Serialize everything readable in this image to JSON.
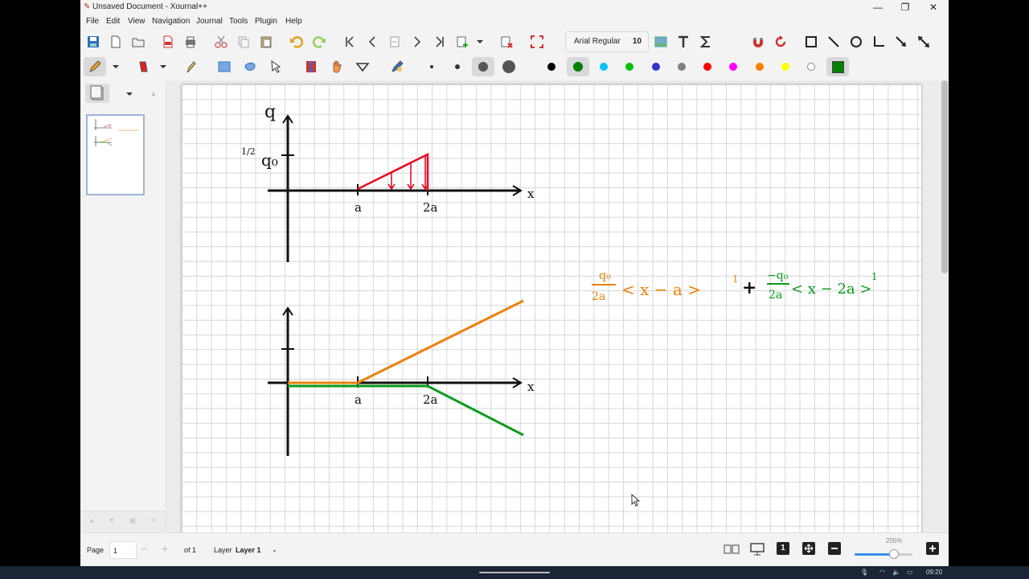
{
  "window": {
    "title": "Unsaved Document - Xournal++",
    "controls": [
      "—",
      "❐",
      "✕"
    ]
  },
  "menu": [
    "File",
    "Edit",
    "View",
    "Navigation",
    "Journal",
    "Tools",
    "Plugin",
    "Help"
  ],
  "toolbar": {
    "font_name": "Arial Regular",
    "font_size": "10",
    "palette": [
      "#000000",
      "#008000",
      "#00c0ff",
      "#00c000",
      "#3333cc",
      "#808080",
      "#ff0000",
      "#ff00ff",
      "#ff8000",
      "#ffff00",
      "#ffffff",
      "#008000"
    ]
  },
  "canvas": {
    "label_q": "q",
    "label_half_q0": "q₀",
    "label_half_frac": "1/2",
    "label_a_top": "a",
    "label_2a_top": "2a",
    "label_x_top": "x",
    "label_a_bot": "a",
    "label_2a_bot": "2a",
    "label_x_bot": "x",
    "eq_orange_num": "q₀",
    "eq_orange_den": "2a",
    "eq_orange_body": "< x − a >",
    "eq_orange_exp": "1",
    "eq_plus": "+",
    "eq_green_num": "−q₀",
    "eq_green_den": "2a",
    "eq_green_body": "< x − 2a >",
    "eq_green_exp": "1",
    "colors": {
      "red": "#e0102a",
      "orange": "#e8820a",
      "green": "#0b9a1e",
      "ink": "#111111"
    }
  },
  "status": {
    "page_label": "Page",
    "page_value": "1",
    "of_label": "of 1",
    "layer_label": "Layer",
    "layer_value": "Layer 1",
    "zoom": "205%"
  },
  "taskbar": {
    "clock": "09:20"
  }
}
